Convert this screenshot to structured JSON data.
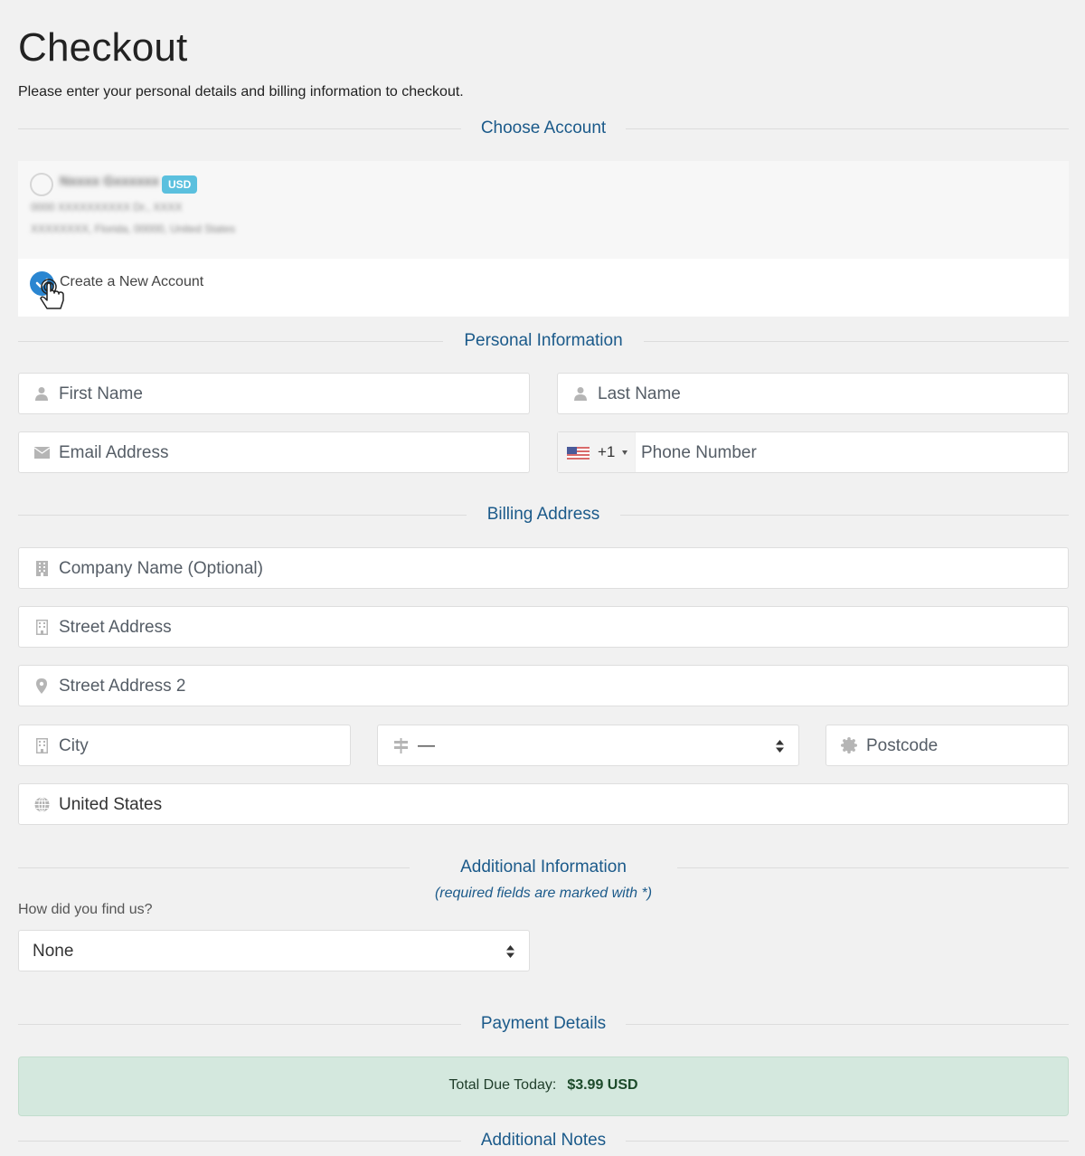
{
  "page": {
    "title": "Checkout",
    "subtitle": "Please enter your personal details and billing information to checkout."
  },
  "sections": {
    "choose_account": "Choose Account",
    "personal_information": "Personal Information",
    "billing_address": "Billing Address",
    "additional_information": "Additional Information",
    "payment_details": "Payment Details",
    "additional_notes": "Additional Notes"
  },
  "account": {
    "existing": {
      "name": "Nxxxx Gxxxxxx",
      "currency_badge": "USD",
      "address_line1": "0000 XXXXXXXXXX Dr., XXXX",
      "address_line2": "XXXXXXXX, Florida, 00000, United States",
      "selected": false
    },
    "new": {
      "label": "Create a New Account",
      "selected": true
    }
  },
  "personal": {
    "first_name_placeholder": "First Name",
    "last_name_placeholder": "Last Name",
    "email_placeholder": "Email Address",
    "phone_country_code": "+1",
    "phone_placeholder": "Phone Number"
  },
  "billing": {
    "company_placeholder": "Company Name (Optional)",
    "street_placeholder": "Street Address",
    "street2_placeholder": "Street Address 2",
    "city_placeholder": "City",
    "state_value": "—",
    "postcode_placeholder": "Postcode",
    "country_value": "United States"
  },
  "additional": {
    "required_note": "(required fields are marked with *)",
    "how_found_label": "How did you find us?",
    "how_found_value": "None"
  },
  "payment": {
    "total_label": "Total Due Today:",
    "total_amount": "$3.99 USD"
  },
  "colors": {
    "accent": "#1b5a8a",
    "radio_checked": "#2a86d1",
    "badge": "#5bc0de",
    "total_bg": "#d4e8de"
  }
}
